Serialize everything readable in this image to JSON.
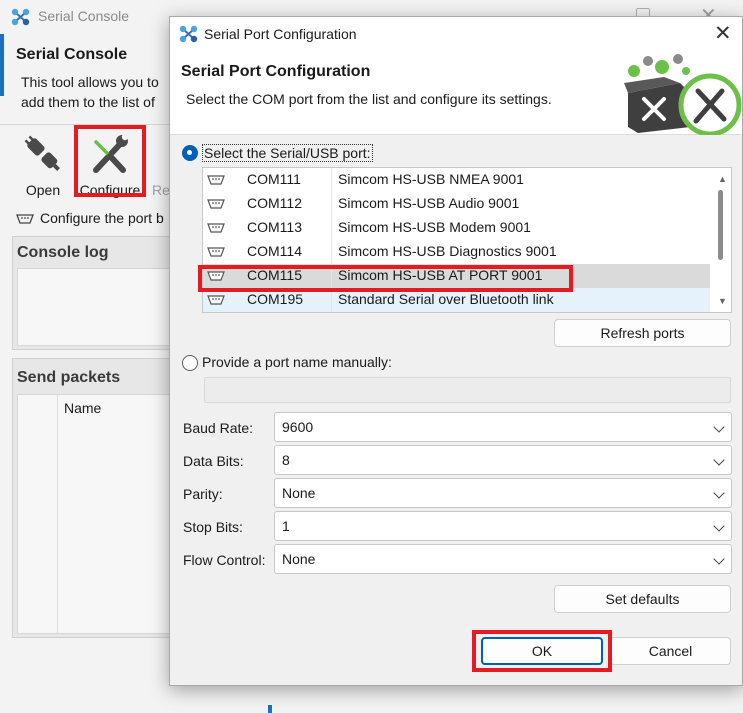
{
  "background_window": {
    "title": "Serial Console",
    "heading": "Serial Console",
    "description_line1": "This tool allows you to",
    "description_line2": "add them to the list of",
    "toolbar": [
      {
        "label": "Open",
        "icon": "plug-icon"
      },
      {
        "label": "Configure",
        "icon": "wrench-screwdriver-icon",
        "highlighted": true
      },
      {
        "label": "Re",
        "icon": "partial-icon"
      }
    ],
    "configure_hint": "Configure the port b",
    "console_log_title": "Console log",
    "send_packets_title": "Send packets",
    "send_packets_column": "Name"
  },
  "dialog": {
    "title": "Serial Port Configuration",
    "heading": "Serial Port Configuration",
    "subheading": "Select the COM port from the list and configure its settings.",
    "close_glyph": "✕",
    "select_port_label": "Select the Serial/USB port:",
    "ports": [
      {
        "com": "COM111",
        "desc": "Simcom HS-USB NMEA 9001"
      },
      {
        "com": "COM112",
        "desc": "Simcom HS-USB Audio 9001"
      },
      {
        "com": "COM113",
        "desc": "Simcom HS-USB Modem 9001"
      },
      {
        "com": "COM114",
        "desc": "Simcom HS-USB Diagnostics 9001"
      },
      {
        "com": "COM115",
        "desc": "Simcom HS-USB AT PORT 9001"
      },
      {
        "com": "COM195",
        "desc": "Standard Serial over Bluetooth link"
      }
    ],
    "selected_port": "COM115",
    "refresh_button": "Refresh ports",
    "manual_port_label": "Provide a port name manually:",
    "manual_port_value": "",
    "settings": {
      "baud_rate": {
        "label": "Baud Rate:",
        "value": "9600"
      },
      "data_bits": {
        "label": "Data Bits:",
        "value": "8"
      },
      "parity": {
        "label": "Parity:",
        "value": "None"
      },
      "stop_bits": {
        "label": "Stop Bits:",
        "value": "1"
      },
      "flow_control": {
        "label": "Flow Control:",
        "value": "None"
      }
    },
    "set_defaults_button": "Set defaults",
    "ok_button": "OK",
    "cancel_button": "Cancel"
  },
  "colors": {
    "highlight_red": "#e31b23",
    "accent_blue": "#005fb8",
    "selected_row": "#dadada",
    "logo_green": "#6cc04a"
  }
}
